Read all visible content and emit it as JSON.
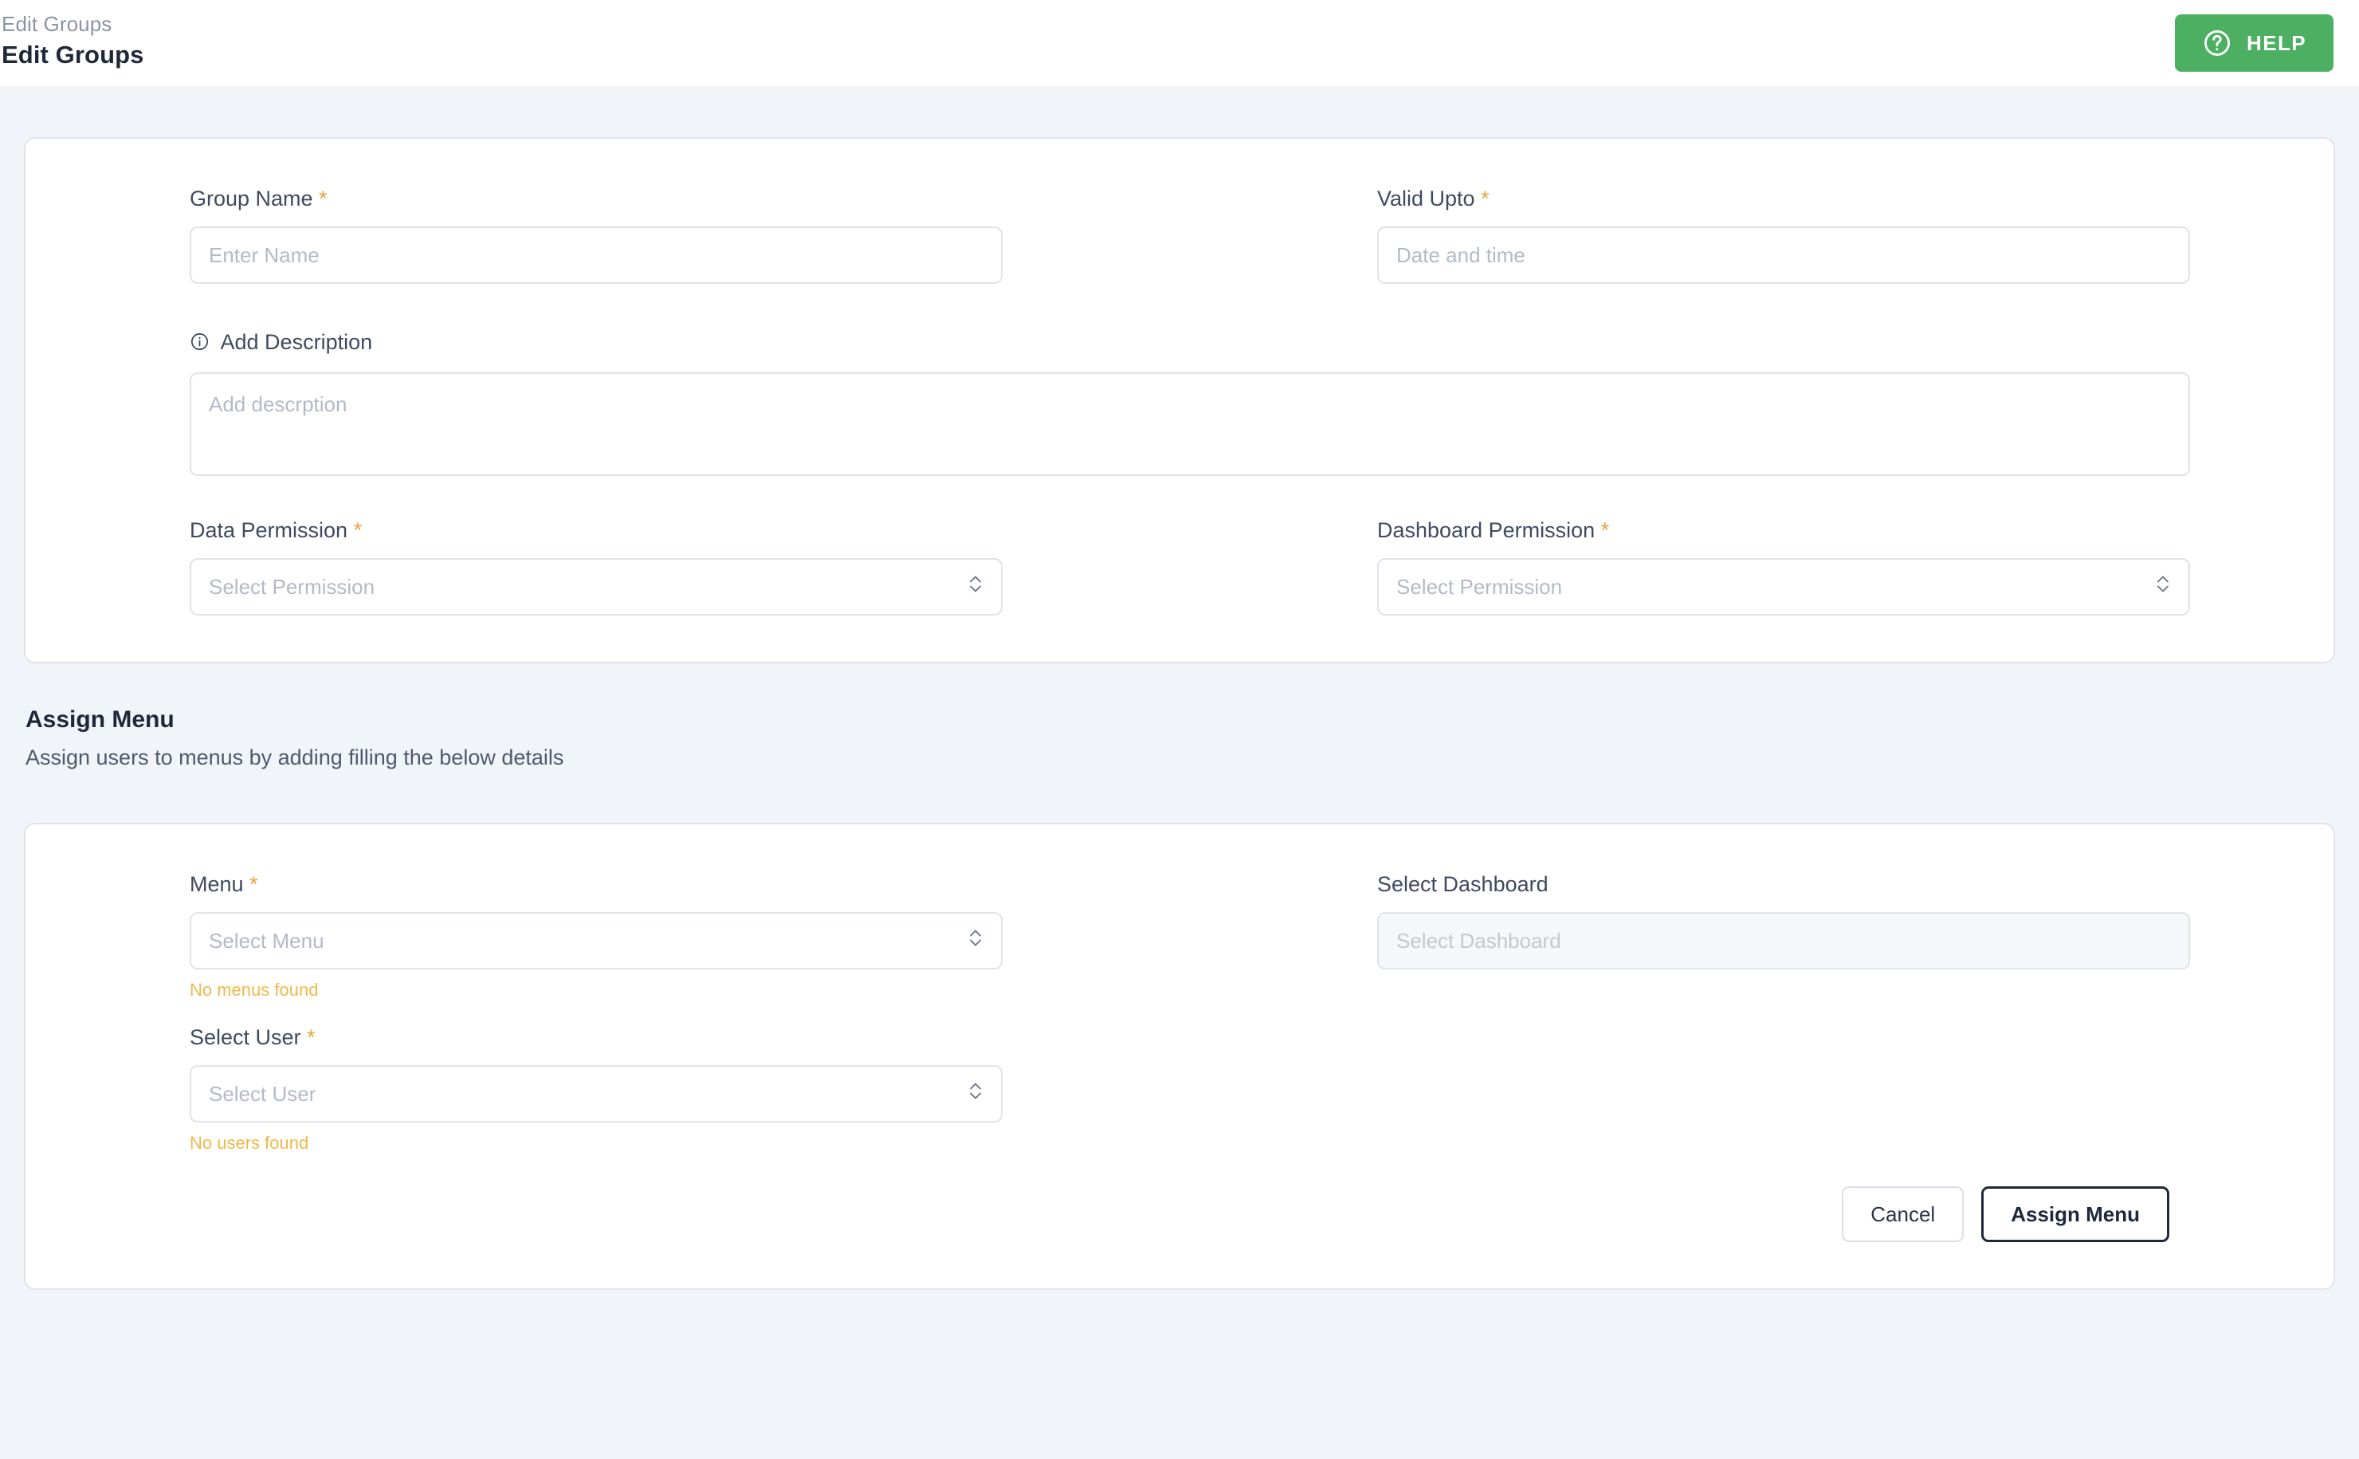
{
  "header": {
    "breadcrumb": "Edit Groups",
    "title": "Edit Groups",
    "help_label": "HELP",
    "help_icon": "question-circle-icon",
    "accent_green": "#4caf62"
  },
  "group_form": {
    "group_name": {
      "label": "Group Name",
      "required_mark": "*",
      "placeholder": "Enter Name",
      "value": ""
    },
    "valid_upto": {
      "label": "Valid Upto",
      "required_mark": "*",
      "placeholder": "Date and time",
      "value": ""
    },
    "description": {
      "label": "Add Description",
      "icon": "info-circle-icon",
      "placeholder": "Add descrption",
      "value": ""
    },
    "data_permission": {
      "label": "Data Permission",
      "required_mark": "*",
      "placeholder": "Select Permission",
      "value": ""
    },
    "dashboard_permission": {
      "label": "Dashboard Permission",
      "required_mark": "*",
      "placeholder": "Select Permission",
      "value": ""
    }
  },
  "assign_section": {
    "title": "Assign Menu",
    "subtitle": "Assign users to menus by adding filling the below details"
  },
  "assign_form": {
    "menu": {
      "label": "Menu",
      "required_mark": "*",
      "placeholder": "Select Menu",
      "value": "",
      "hint": "No menus found"
    },
    "dashboard": {
      "label": "Select Dashboard",
      "required_mark": "",
      "placeholder": "Select Dashboard",
      "value": "",
      "disabled": true
    },
    "user": {
      "label": "Select User",
      "required_mark": "*",
      "placeholder": "Select User",
      "value": "",
      "hint": "No users found"
    },
    "cancel_label": "Cancel",
    "submit_label": "Assign Menu",
    "hint_color": "#f0b849",
    "required_color": "#e8a33d"
  }
}
